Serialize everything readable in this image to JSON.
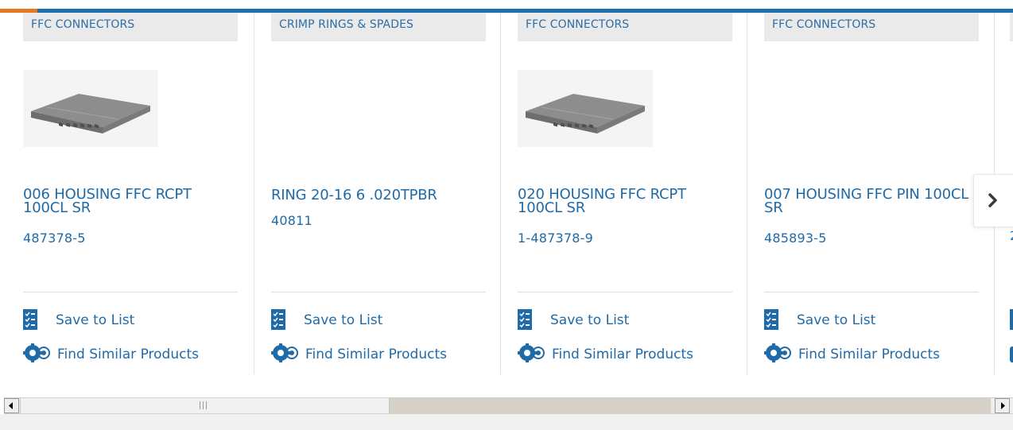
{
  "colors": {
    "brand_blue": "#1a6fb0",
    "link_blue": "#1f6aa8",
    "accent_orange": "#e87722",
    "category_bg": "#eaeaea"
  },
  "cards": [
    {
      "category": "FFC CONNECTORS",
      "title": "006 HOUSING FFC RCPT 100CL SR",
      "part_number": "487378-5",
      "save_label": "Save to List",
      "similar_label": "Find Similar Products",
      "has_image": true
    },
    {
      "category": "CRIMP RINGS & SPADES",
      "title": "RING 20-16 6 .020TPBR",
      "part_number": "40811",
      "save_label": "Save to List",
      "similar_label": "Find Similar Products",
      "has_image": false
    },
    {
      "category": "FFC CONNECTORS",
      "title": "020 HOUSING FFC RCPT 100CL SR",
      "part_number": "1-487378-9",
      "save_label": "Save to List",
      "similar_label": "Find Similar Products",
      "has_image": true
    },
    {
      "category": "FFC CONNECTORS",
      "title": "007 HOUSING FFC PIN 100CL SR",
      "part_number": "485893-5",
      "save_label": "Save to List",
      "similar_label": "Find Similar Products",
      "has_image": false
    }
  ],
  "partial_card": {
    "part_number_fragment": "2"
  },
  "icons": {
    "save": "checklist-icon",
    "similar": "gears-icon",
    "next": "chevron-right-icon"
  }
}
